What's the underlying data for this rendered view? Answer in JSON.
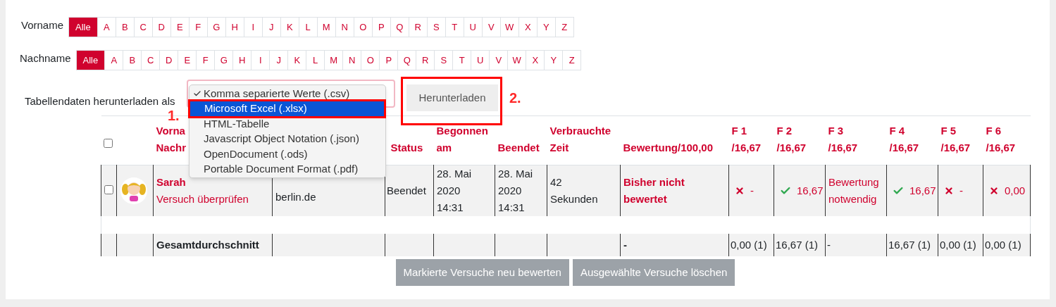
{
  "filters": [
    {
      "label": "Vorname",
      "letters": [
        {
          "text": "Alle",
          "selected": true
        },
        {
          "text": "A",
          "selected": false
        },
        {
          "text": "B",
          "selected": false
        },
        {
          "text": "C",
          "selected": false
        },
        {
          "text": "D",
          "selected": false
        },
        {
          "text": "E",
          "selected": false
        },
        {
          "text": "F",
          "selected": false
        },
        {
          "text": "G",
          "selected": false
        },
        {
          "text": "H",
          "selected": false
        },
        {
          "text": "I",
          "selected": false
        },
        {
          "text": "J",
          "selected": false
        },
        {
          "text": "K",
          "selected": false
        },
        {
          "text": "L",
          "selected": false
        },
        {
          "text": "M",
          "selected": false
        },
        {
          "text": "N",
          "selected": false
        },
        {
          "text": "O",
          "selected": false
        },
        {
          "text": "P",
          "selected": false
        },
        {
          "text": "Q",
          "selected": false
        },
        {
          "text": "R",
          "selected": false
        },
        {
          "text": "S",
          "selected": false
        },
        {
          "text": "T",
          "selected": false
        },
        {
          "text": "U",
          "selected": false
        },
        {
          "text": "V",
          "selected": false
        },
        {
          "text": "W",
          "selected": false
        },
        {
          "text": "X",
          "selected": false
        },
        {
          "text": "Y",
          "selected": false
        },
        {
          "text": "Z",
          "selected": false
        }
      ]
    },
    {
      "label": "Nachname",
      "letters": [
        {
          "text": "Alle",
          "selected": true
        },
        {
          "text": "A",
          "selected": false
        },
        {
          "text": "B",
          "selected": false
        },
        {
          "text": "C",
          "selected": false
        },
        {
          "text": "D",
          "selected": false
        },
        {
          "text": "E",
          "selected": false
        },
        {
          "text": "F",
          "selected": false
        },
        {
          "text": "G",
          "selected": false
        },
        {
          "text": "H",
          "selected": false
        },
        {
          "text": "I",
          "selected": false
        },
        {
          "text": "J",
          "selected": false
        },
        {
          "text": "K",
          "selected": false
        },
        {
          "text": "L",
          "selected": false
        },
        {
          "text": "M",
          "selected": false
        },
        {
          "text": "N",
          "selected": false
        },
        {
          "text": "O",
          "selected": false
        },
        {
          "text": "P",
          "selected": false
        },
        {
          "text": "Q",
          "selected": false
        },
        {
          "text": "R",
          "selected": false
        },
        {
          "text": "S",
          "selected": false
        },
        {
          "text": "T",
          "selected": false
        },
        {
          "text": "U",
          "selected": false
        },
        {
          "text": "V",
          "selected": false
        },
        {
          "text": "W",
          "selected": false
        },
        {
          "text": "X",
          "selected": false
        },
        {
          "text": "Y",
          "selected": false
        },
        {
          "text": "Z",
          "selected": false
        }
      ]
    }
  ],
  "download": {
    "label": "Tabellendaten herunterladen als",
    "options": [
      {
        "text": "Komma separierte Werte (.csv)",
        "checked": true,
        "selected": false
      },
      {
        "text": "Microsoft Excel (.xlsx)",
        "checked": false,
        "selected": true
      },
      {
        "text": "HTML-Tabelle",
        "checked": false,
        "selected": false
      },
      {
        "text": "Javascript Object Notation (.json)",
        "checked": false,
        "selected": false
      },
      {
        "text": "OpenDocument (.ods)",
        "checked": false,
        "selected": false
      },
      {
        "text": "Portable Document Format (.pdf)",
        "checked": false,
        "selected": false
      }
    ],
    "button": "Herunterladen",
    "marks": [
      "1.",
      "2."
    ]
  },
  "table": {
    "select_all": {
      "checked": false
    },
    "columns": [
      {
        "lines": [
          "Vorna",
          "Nachr"
        ]
      },
      {
        "lines": [
          "Status"
        ]
      },
      {
        "lines": [
          "Begonnen",
          "am"
        ]
      },
      {
        "lines": [
          "Beendet"
        ]
      },
      {
        "lines": [
          "Verbrauchte",
          "Zeit"
        ]
      },
      {
        "lines": [
          "Bewertung/100,00"
        ]
      },
      {
        "lines": [
          "F 1",
          "/16,67"
        ]
      },
      {
        "lines": [
          "F 2",
          "/16,67"
        ]
      },
      {
        "lines": [
          "F 3",
          "/16,67"
        ]
      },
      {
        "lines": [
          "F 4",
          "/16,67"
        ]
      },
      {
        "lines": [
          "F 5",
          "/16,67"
        ]
      },
      {
        "lines": [
          "F 6",
          "/16,67"
        ]
      }
    ],
    "rows": [
      {
        "checked": false,
        "name": "Sarah",
        "review_link": "Versuch überprüfen",
        "email": "berlin.de",
        "status": "Beendet",
        "started": [
          "28. Mai",
          "2020",
          "14:31"
        ],
        "finished": [
          "28. Mai",
          "2020",
          "14:31"
        ],
        "duration": [
          "42",
          "Sekunden"
        ],
        "grade": [
          "Bisher nicht",
          "bewertet"
        ],
        "questions": [
          {
            "kind": "wrong",
            "text": "-"
          },
          {
            "kind": "correct",
            "text": "16,67"
          },
          {
            "kind": "pending",
            "text": "Bewertung notwendig"
          },
          {
            "kind": "correct",
            "text": "16,67"
          },
          {
            "kind": "wrong",
            "text": "-"
          },
          {
            "kind": "wrong",
            "text": "0,00"
          }
        ]
      }
    ],
    "summary": {
      "label": "Gesamtdurchschnitt",
      "grade": "-",
      "questions": [
        "0,00 (1)",
        "16,67 (1)",
        "-",
        "16,67 (1)",
        "0,00 (1)",
        "0,00 (1)"
      ]
    }
  },
  "buttons": [
    "Markierte Versuche neu bewerten",
    "Ausgewählte Versuche löschen"
  ]
}
